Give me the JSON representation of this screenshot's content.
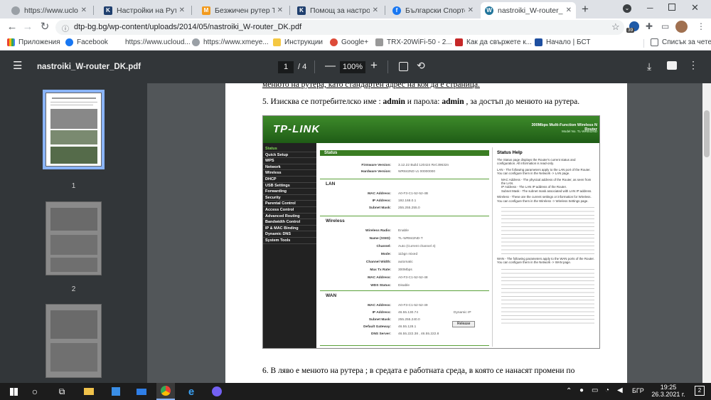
{
  "tabs": [
    {
      "title": "https://www.ucloudcar",
      "favicon": "#9aa0a6",
      "letter": ""
    },
    {
      "title": "Настройки на Рутер T",
      "favicon": "#1f3f6e",
      "letter": "K"
    },
    {
      "title": "Безжичен рутер TP-L",
      "favicon": "#f29a1d",
      "letter": "M"
    },
    {
      "title": "Помощ за настройка",
      "favicon": "#1f3f6e",
      "letter": "K"
    },
    {
      "title": "Български Спортен Т",
      "favicon": "#1877f2",
      "letter": "f"
    },
    {
      "title": "nastroiki_W-router_DK",
      "favicon": "#21759b",
      "letter": "W"
    }
  ],
  "toolbar": {
    "url": "dtp-bg.bg/wp-content/uploads/2014/05/nastroiki_W-router_DK.pdf",
    "ext_badge": "39"
  },
  "bookmarks": [
    "Приложения",
    "Facebook",
    "https://www.ucloud...",
    "https://www.xmeye...",
    "Инструкции",
    "Google+",
    "TRX-20WiFi-50 - 2...",
    "Как да свържете к...",
    "Начало | БСТ"
  ],
  "bookmarks_other": "Списък за чете",
  "pdf": {
    "filename": "nastroiki_W-router_DK.pdf",
    "page": "1",
    "total": "/ 4",
    "zoom": "100%"
  },
  "thumbs": [
    "1",
    "2"
  ],
  "doc": {
    "line_top": "менюто на рутера, като стандартен адрес на коя да е страница.",
    "step5_pre": "5. Изисква се потребителско име : ",
    "step5_b1": "admin",
    "step5_mid": " и парола: ",
    "step5_b2": "admin",
    "step5_post": " , за достъп до менюто на рутера.",
    "step6": "6. В ляво е менюто на рутера ; в средата е работната среда, в която се нанасят промени по"
  },
  "router": {
    "logo": "TP-LINK",
    "model_title": "300Mbps Multi-Function Wireless N Router",
    "model_no": "Model No. TL-WR842ND",
    "nav": [
      "Status",
      "Quick Setup",
      "WPS",
      "Network",
      "Wireless",
      "DHCP",
      "USB Settings",
      "Forwarding",
      "Security",
      "Parental Control",
      "Access Control",
      "Advanced Routing",
      "Bandwidth Control",
      "IP & MAC Binding",
      "Dynamic DNS",
      "System Tools"
    ],
    "status_label": "Status",
    "fw_k": "Firmware Version:",
    "fw_v": "3.12.22 Build 120424 Rel.39632n",
    "hw_k": "Hardware Version:",
    "hw_v": "WR842ND v1 00000000",
    "lan": "LAN",
    "lan_rows": [
      [
        "MAC Address:",
        "A0-F3-C1-52-52-4B"
      ],
      [
        "IP Address:",
        "192.168.0.1"
      ],
      [
        "Subnet Mask:",
        "255.255.255.0"
      ]
    ],
    "wireless": "Wireless",
    "wl_rows": [
      [
        "Wireless Radio:",
        "Enable"
      ],
      [
        "Name (SSID):",
        "TL-WR842ND-T"
      ],
      [
        "Channel:",
        "Auto (Current channel 4)"
      ],
      [
        "Mode:",
        "11bgn mixed"
      ],
      [
        "Channel Width:",
        "automatic"
      ],
      [
        "Max Tx Rate:",
        "300Mbps"
      ],
      [
        "MAC Address:",
        "A0-F3-C1-52-52-48"
      ],
      [
        "WDS Status:",
        "Disable"
      ]
    ],
    "wan": "WAN",
    "wan_rows": [
      [
        "MAC Address:",
        "A0-F3-C1-52-52-49",
        ""
      ],
      [
        "IP Address:",
        "46.55.130.74",
        "Dynamic IP"
      ],
      [
        "Subnet Mask:",
        "255.255.240.0",
        ""
      ],
      [
        "Default Gateway:",
        "46.55.128.1",
        ""
      ],
      [
        "DNS Server:",
        "46.55.222.38 , 46.55.222.8",
        ""
      ]
    ],
    "release": "Release",
    "help_title": "Status Help",
    "help_p1": "The Status page displays the Router's current status and configuration. All information is read-only.",
    "help_lan": "LAN - The following parameters apply to the LAN port of the Router. You can configure them in the Network -> LAN page.",
    "help_b1": "MAC Address - The physical address of the Router, as seen from the LAN.",
    "help_b2": "IP Address - The LAN IP address of the Router.",
    "help_b3": "Subnet Mask - The subnet mask associated with LAN IP address.",
    "help_wl": "Wireless - These are the current settings or information for Wireless. You can configure them in the Wireless -> Wireless Settings page.",
    "help_wan": "WAN - The following parameters apply to the WAN ports of the Router. You can configure them in the Network -> WAN page."
  },
  "taskbar": {
    "time": "19:25",
    "date": "26.3.2021 г.",
    "lang": "БГР",
    "notif": "2"
  }
}
